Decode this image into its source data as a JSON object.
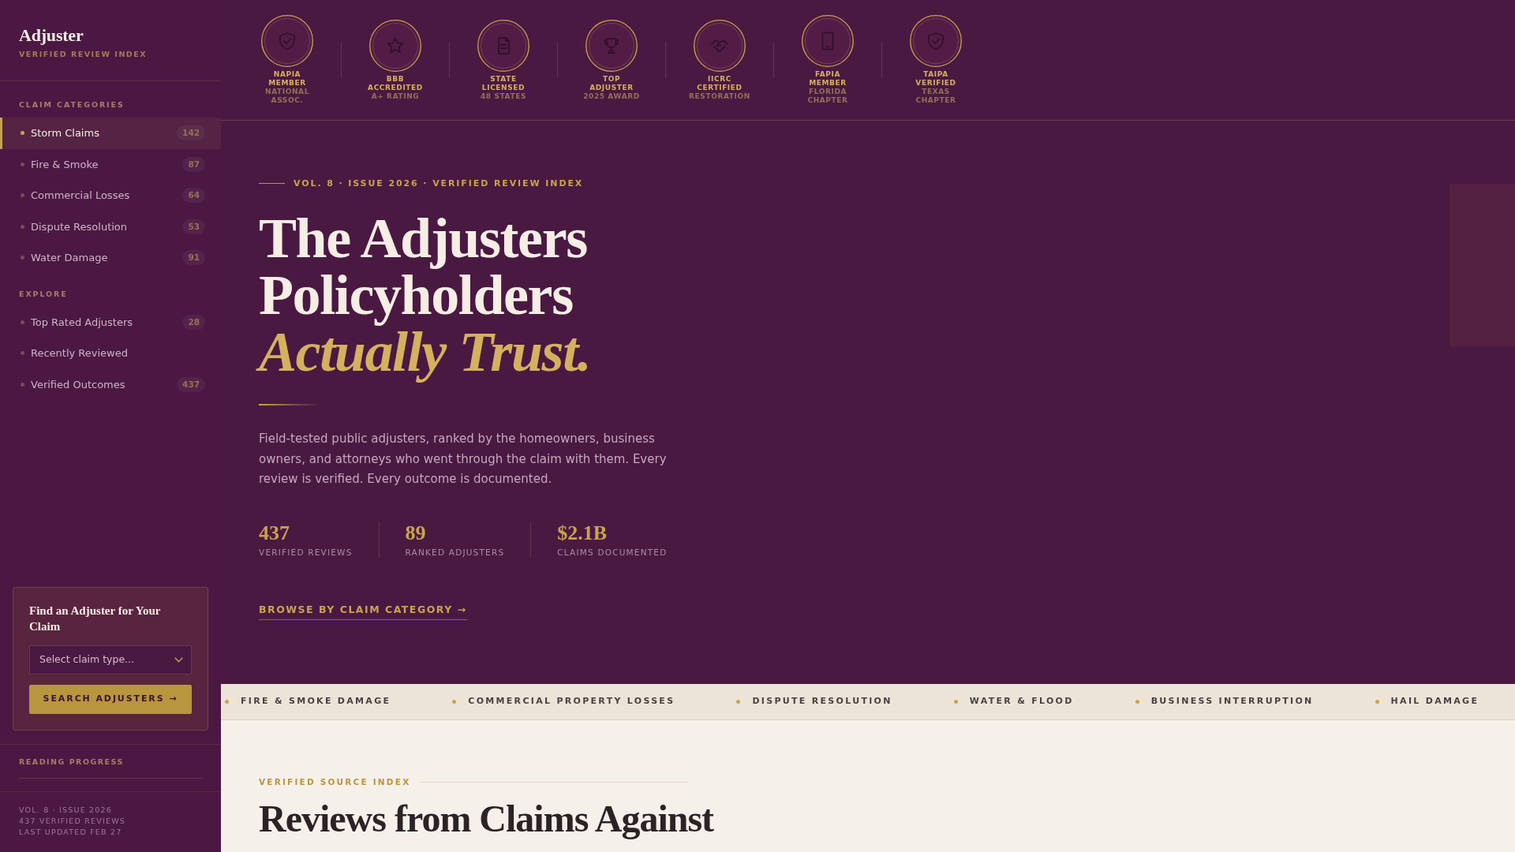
{
  "sidebar": {
    "brand": {
      "title": "Adjuster",
      "subtitle": "VERIFIED REVIEW INDEX"
    },
    "nav_sections": [
      {
        "heading": "CLAIM CATEGORIES",
        "items": [
          {
            "label": "Storm Claims",
            "count": "142",
            "selected": true
          },
          {
            "label": "Fire & Smoke",
            "count": "87",
            "selected": false
          },
          {
            "label": "Commercial Losses",
            "count": "64",
            "selected": false
          },
          {
            "label": "Dispute Resolution",
            "count": "53",
            "selected": false
          },
          {
            "label": "Water Damage",
            "count": "91",
            "selected": false
          }
        ]
      },
      {
        "heading": "EXPLORE",
        "items": [
          {
            "label": "Top Rated Adjusters",
            "count": "28",
            "selected": false
          },
          {
            "label": "Recently Reviewed",
            "selected": false
          },
          {
            "label": "Verified Outcomes",
            "count": "437",
            "selected": false
          }
        ]
      }
    ],
    "search_card": {
      "title": "Find an Adjuster for Your Claim",
      "claim_type": {
        "placeholder": "Select claim type..."
      },
      "button": "SEARCH ADJUSTERS →"
    },
    "reading_progress": {
      "label": "READING PROGRESS"
    },
    "footer_lines": [
      "VOL. 8 · ISSUE 2026",
      "437 VERIFIED REVIEWS",
      "LAST UPDATED FEB 27"
    ]
  },
  "credentials": [
    {
      "name": "NAPIA MEMBER",
      "detail": "NATIONAL ASSOC."
    },
    {
      "name": "BBB ACCREDITED",
      "detail": "A+ RATING"
    },
    {
      "name": "STATE LICENSED",
      "detail": "48 STATES"
    },
    {
      "name": "TOP ADJUSTER",
      "detail": "2025 AWARD"
    },
    {
      "name": "IICRC CERTIFIED",
      "detail": "RESTORATION"
    },
    {
      "name": "FAPIA MEMBER",
      "detail": "FLORIDA CHAPTER"
    },
    {
      "name": "TAIPA VERIFIED",
      "detail": "TEXAS CHAPTER"
    }
  ],
  "hero": {
    "eyebrow": "VOL. 8 · ISSUE 2026 · VERIFIED REVIEW INDEX",
    "title": "The Adjusters Policyholders *Actually Trust.*",
    "intro": "Field-tested public adjusters, ranked by the homeowners, business owners, and attorneys who went through the claim with them. Every review is verified. Every outcome is documented.",
    "stats": [
      {
        "value": "437",
        "label": "VERIFIED REVIEWS"
      },
      {
        "value": "89",
        "label": "RANKED ADJUSTERS"
      },
      {
        "value": "$2.1B",
        "label": "CLAIMS DOCUMENTED"
      }
    ],
    "link": "BROWSE BY CLAIM CATEGORY →"
  },
  "ticker": [
    "FIRE & SMOKE DAMAGE",
    "COMMERCIAL PROPERTY LOSSES",
    "DISPUTE RESOLUTION",
    "WATER & FLOOD",
    "BUSINESS INTERRUPTION",
    "HAIL DAMAGE"
  ],
  "source_index": {
    "eyebrow": "VERIFIED SOURCE INDEX",
    "title": "Reviews from Claims Against"
  }
}
